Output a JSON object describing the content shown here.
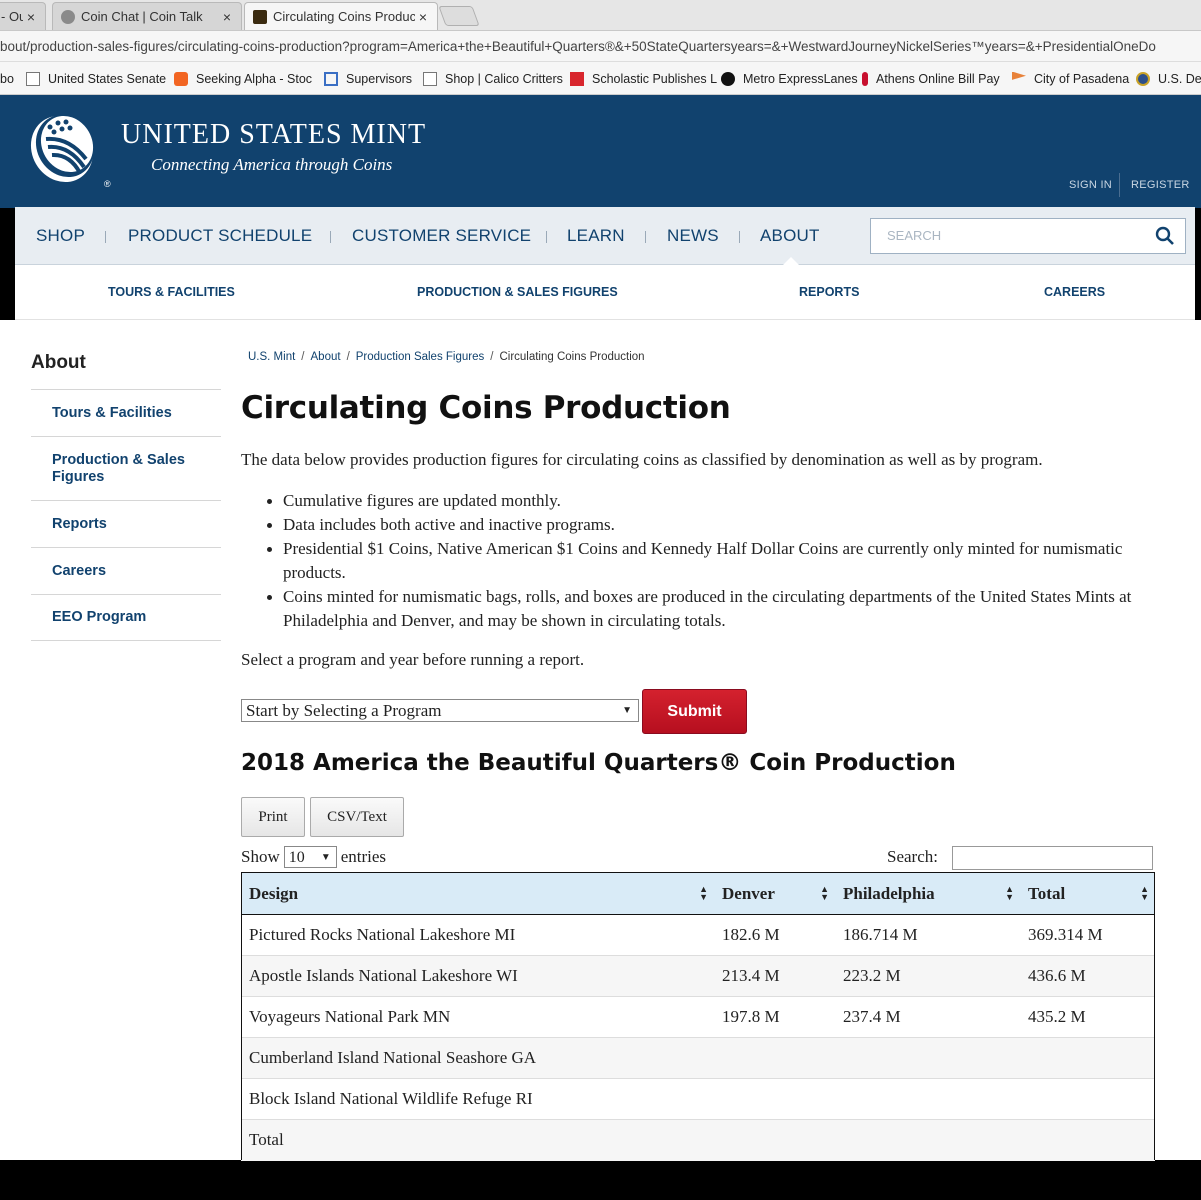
{
  "browser": {
    "tabs": [
      {
        "label": "- Ou",
        "close": "×"
      },
      {
        "label": "Coin Chat | Coin Talk",
        "close": "×"
      },
      {
        "label": "Circulating Coins Product",
        "close": "×"
      }
    ],
    "url": "bout/production-sales-figures/circulating-coins-production?program=America+the+Beautiful+Quarters®&+50StateQuartersyears=&+WestwardJourneyNickelSeries™years=&+PresidentialOneDo",
    "bookmarks": [
      {
        "label": "bo",
        "icon": "bookmark-icon"
      },
      {
        "label": "United States Senate",
        "icon": "page-icon"
      },
      {
        "label": "Seeking Alpha - Stoc",
        "icon": "alpha-icon"
      },
      {
        "label": "Supervisors",
        "icon": "grid-icon"
      },
      {
        "label": "Shop | Calico Critters",
        "icon": "page-icon"
      },
      {
        "label": "Scholastic Publishes L",
        "icon": "s-icon"
      },
      {
        "label": "Metro ExpressLanes",
        "icon": "m-icon"
      },
      {
        "label": "Athens Online Bill Pay",
        "icon": "flame-icon"
      },
      {
        "label": "City of Pasadena",
        "icon": "flag-icon"
      },
      {
        "label": "U.S. Dep",
        "icon": "seal-icon"
      }
    ]
  },
  "header": {
    "brand": "UNITED STATES MINT",
    "tagline": "Connecting America through Coins",
    "reg": "®",
    "sign_in": "SIGN IN",
    "register": "REGISTER"
  },
  "nav": {
    "items": [
      "SHOP",
      "PRODUCT SCHEDULE",
      "CUSTOMER SERVICE",
      "LEARN",
      "NEWS",
      "ABOUT"
    ],
    "search_placeholder": "SEARCH",
    "subnav": [
      "TOURS & FACILITIES",
      "PRODUCTION & SALES FIGURES",
      "REPORTS",
      "CAREERS"
    ]
  },
  "sidebar": {
    "title": "About",
    "items": [
      "Tours & Facilities",
      "Production & Sales Figures",
      "Reports",
      "Careers",
      "EEO Program"
    ]
  },
  "breadcrumb": [
    "U.S. Mint",
    "About",
    "Production Sales Figures",
    "Circulating Coins Production"
  ],
  "page": {
    "title": "Circulating Coins Production",
    "intro": "The data below provides production figures for circulating coins as classified by denomination as well as by program.",
    "bullets": [
      "Cumulative figures are updated monthly.",
      "Data includes both active and inactive programs.",
      "Presidential $1 Coins, Native American $1 Coins and Kennedy Half Dollar Coins are currently only minted for numismatic products.",
      "Coins minted for numismatic bags, rolls, and boxes are produced in the circulating departments of the United States Mints at Philadelphia and Denver, and may be shown in circulating totals."
    ],
    "select_prompt": "Select a program and year before running a report.",
    "program_select": "Start by Selecting a Program",
    "submit": "Submit",
    "report_title": "2018 America the Beautiful Quarters® Coin Production"
  },
  "table": {
    "print": "Print",
    "csv": "CSV/Text",
    "show": "Show",
    "entries_value": "10",
    "entries": "entries",
    "search_label": "Search:",
    "columns": [
      "Design",
      "Denver",
      "Philadelphia",
      "Total"
    ],
    "rows": [
      [
        "Pictured Rocks National Lakeshore MI",
        "182.6 M",
        "186.714 M",
        "369.314 M"
      ],
      [
        "Apostle Islands National Lakeshore WI",
        "213.4 M",
        "223.2 M",
        "436.6 M"
      ],
      [
        "Voyageurs National Park MN",
        "197.8 M",
        "237.4 M",
        "435.2 M"
      ],
      [
        "Cumberland Island National Seashore GA",
        "",
        "",
        ""
      ],
      [
        "Block Island National Wildlife Refuge RI",
        "",
        "",
        ""
      ],
      [
        "Total",
        "",
        "",
        ""
      ]
    ]
  }
}
